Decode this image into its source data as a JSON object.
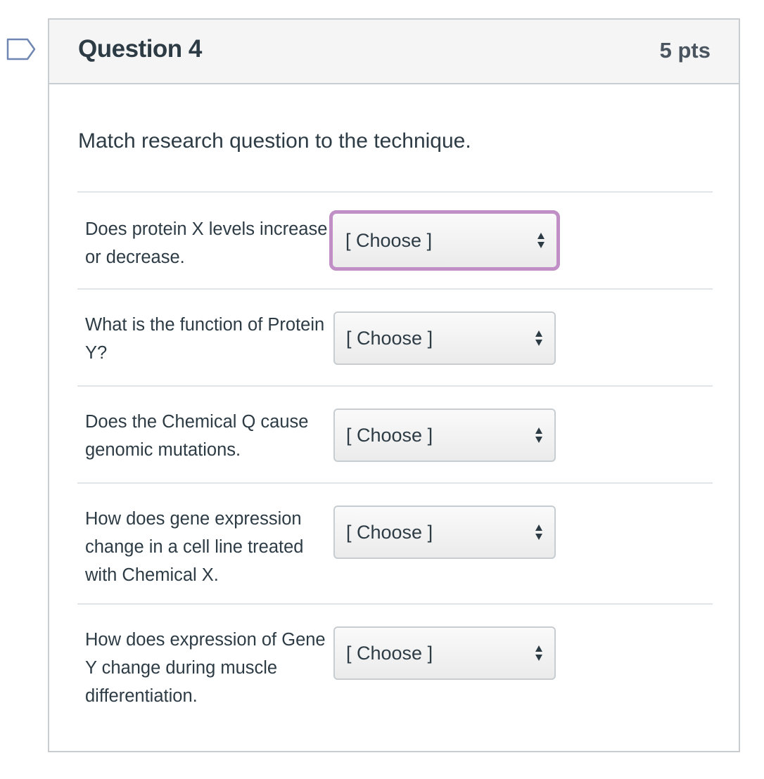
{
  "question": {
    "title": "Question 4",
    "points": "5 pts",
    "prompt": "Match research question to the technique."
  },
  "answers": [
    {
      "label": "Does protein X levels increase or decrease.",
      "selected": "[ Choose ]",
      "focused": true
    },
    {
      "label": "What is the function of Protein Y?",
      "selected": "[ Choose ]",
      "focused": false
    },
    {
      "label": "Does the Chemical Q cause genomic mutations.",
      "selected": "[ Choose ]",
      "focused": false
    },
    {
      "label": "How does gene expression change in a cell line treated with Chemical X.",
      "selected": "[ Choose ]",
      "focused": false
    },
    {
      "label": "How does expression of Gene Y change during muscle differentiation.",
      "selected": "[ Choose ]",
      "focused": false
    }
  ],
  "icons": {
    "flag": "flag-outline-icon",
    "select_arrows": "up-down-arrows-icon"
  },
  "colors": {
    "focus_ring": "#c08fc6",
    "header_bg": "#f5f5f5",
    "border": "#c7cdd1"
  }
}
